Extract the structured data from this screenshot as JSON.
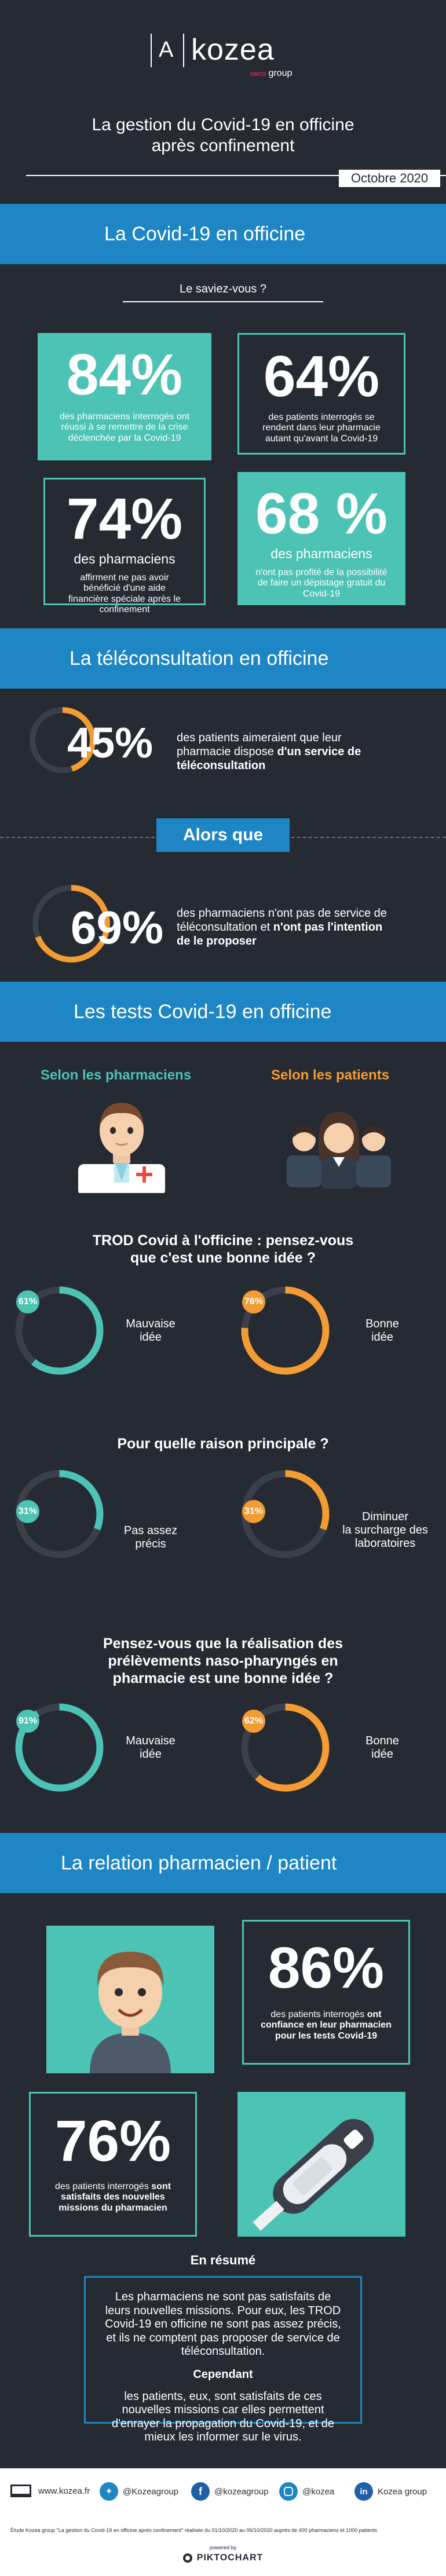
{
  "header": {
    "logo_text": "kozea",
    "logo_sub_brand": "ONCO",
    "logo_sub": "group",
    "title_line1": "La gestion du Covid-19 en officine",
    "title_line2": "après confinement",
    "date": "Octobre 2020"
  },
  "s1": {
    "title": "La Covid-19 en officine",
    "saviez": "Le saviez-vous ?",
    "stat1": {
      "value": "84%",
      "text": "des pharmaciens interrogés ont réussi à se remettre de la crise déclenchée par la Covid-19"
    },
    "stat2": {
      "value": "64%",
      "text": "des patients interrogés se rendent dans leur pharmacie autant qu'avant la Covid-19"
    },
    "stat3": {
      "value": "74%",
      "text_bold": "des pharmaciens",
      "text": "affirment ne pas avoir bénéficié d'une aide financière spéciale après le confinement"
    },
    "stat4": {
      "value": "68 %",
      "text_bold": "des pharmaciens",
      "text": "n'ont pas profité de la possibilité de faire un dépistage gratuit du Covid-19"
    }
  },
  "s2": {
    "title": "La téléconsultation en officine",
    "stat1": {
      "value": "45%",
      "pct": 45,
      "text": "des patients aimeraient que leur pharmacie dispose ",
      "text_bold": "d'un service de téléconsultation"
    },
    "alors": "Alors que",
    "stat2": {
      "value": "69%",
      "pct": 69,
      "text": "des pharmaciens n'ont pas de service de téléconsultation et ",
      "text_bold": "n'ont pas l'intention de le proposer"
    }
  },
  "s3": {
    "title": "Les tests Covid-19 en officine",
    "col_left": "Selon les pharmaciens",
    "col_right": "Selon les patients",
    "q1": {
      "line1": "TROD Covid à l'officine : pensez-vous",
      "line2": "que c'est une bonne idée ?",
      "left": {
        "value": "61%",
        "pct": 61,
        "label1": "Mauvaise",
        "label2": "idée"
      },
      "right": {
        "value": "76%",
        "pct": 76,
        "label1": "Bonne",
        "label2": "idée"
      }
    },
    "q2": {
      "line1": "Pour quelle raison principale ?",
      "left": {
        "value": "31%",
        "pct": 31,
        "label1": "Pas assez",
        "label2": "précis"
      },
      "right": {
        "value": "31%",
        "pct": 31,
        "label1": "Diminuer",
        "label2": "la surcharge des",
        "label3": "laboratoires"
      }
    },
    "q3": {
      "line1": "Pensez-vous que la réalisation des",
      "line2": "prélèvements naso-pharyngés en",
      "line3": "pharmacie est une bonne idée ?",
      "left": {
        "value": "91%",
        "pct": 91,
        "label1": "Mauvaise",
        "label2": "idée"
      },
      "right": {
        "value": "62%",
        "pct": 62,
        "label1": "Bonne",
        "label2": "idée"
      }
    }
  },
  "s4": {
    "title": "La relation pharmacien / patient",
    "stat1": {
      "value": "86%",
      "text": "des patients interrogés ",
      "text_bold": "ont confiance en leur pharmacien pour les tests Covid-19"
    },
    "stat2": {
      "value": "76%",
      "text": "des patients interrogés ",
      "text_bold": "sont satisfaits des nouvelles missions du pharmacien"
    },
    "resume_title": "En résumé",
    "resume_p1": "Les pharmaciens ne sont pas satisfaits de leurs nouvelles missions. Pour eux, les TROD Covid-19 en officine ne sont pas assez précis, et ils ne comptent pas proposer de service de téléconsultation.",
    "cependant": "Cependant",
    "resume_p2": "les patients, eux, sont satisfaits de ces nouvelles missions car elles permettent d'enrayer la propagation du Covid-19, et de mieux les informer sur le virus."
  },
  "footer": {
    "website": "www.kozea.fr",
    "twitter": "@Kozeagroup",
    "facebook": "@kozeagroup",
    "instagram": "@kozea",
    "linkedin": "Kozea group",
    "source": "Étude Kozea group \"La gestion du Covid-19 en officine après confinement\" réalisée du 01/10/2020 au 06/10/2020 auprès de 400 pharmaciens et 1000 patients",
    "powered": "powered by",
    "brand": "PIKTOCHART"
  },
  "colors": {
    "blue": "#1e86c4",
    "teal": "#4cc3b4",
    "orange": "#f39c33",
    "dark": "#262a33"
  }
}
